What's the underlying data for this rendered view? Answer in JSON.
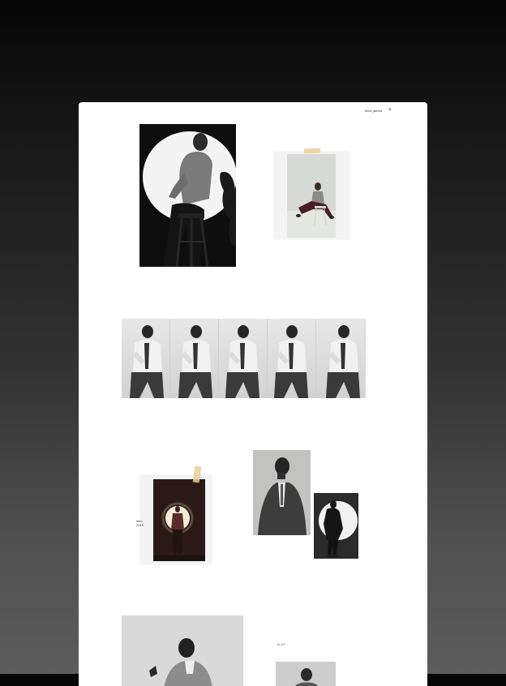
{
  "header": {
    "name": "lebo james",
    "close_label": "×"
  },
  "side_note": {
    "line1": "lebo",
    "line2": "2019"
  },
  "bottom_note": "w 1/7",
  "icons": {
    "close": "close-icon"
  },
  "colors": {
    "background_top": "#050505",
    "background_bottom": "#5c5c5c",
    "window": "#ffffff",
    "tape": "#e8cc96"
  }
}
